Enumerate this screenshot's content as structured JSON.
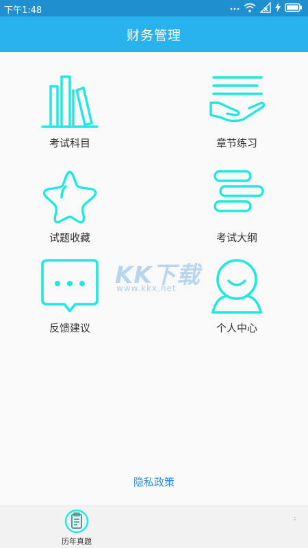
{
  "status_bar": {
    "time": "下午1:48",
    "icons": [
      "dots-icon",
      "wifi-icon",
      "signal-icon",
      "charging-icon",
      "battery-icon"
    ]
  },
  "header": {
    "title": "财务管理"
  },
  "menu": [
    {
      "label": "考试科目",
      "icon": "books-icon"
    },
    {
      "label": "章节练习",
      "icon": "hand-lines-icon"
    },
    {
      "label": "试题收藏",
      "icon": "star-icon"
    },
    {
      "label": "考试大纲",
      "icon": "outline-bars-icon"
    },
    {
      "label": "反馈建议",
      "icon": "chat-bubble-icon"
    },
    {
      "label": "个人中心",
      "icon": "user-icon"
    }
  ],
  "watermark": {
    "main": "KK下载",
    "url": "www.kkx.net"
  },
  "privacy": {
    "label": "隐私政策"
  },
  "bottom_nav": {
    "tabs": [
      {
        "label": "历年真题",
        "icon": "exam-paper-icon"
      }
    ]
  },
  "colors": {
    "status_bar": "#1f8fd0",
    "header": "#29b3ec",
    "icon_cyan": "#1de9e0",
    "link": "#2d8fe0"
  }
}
